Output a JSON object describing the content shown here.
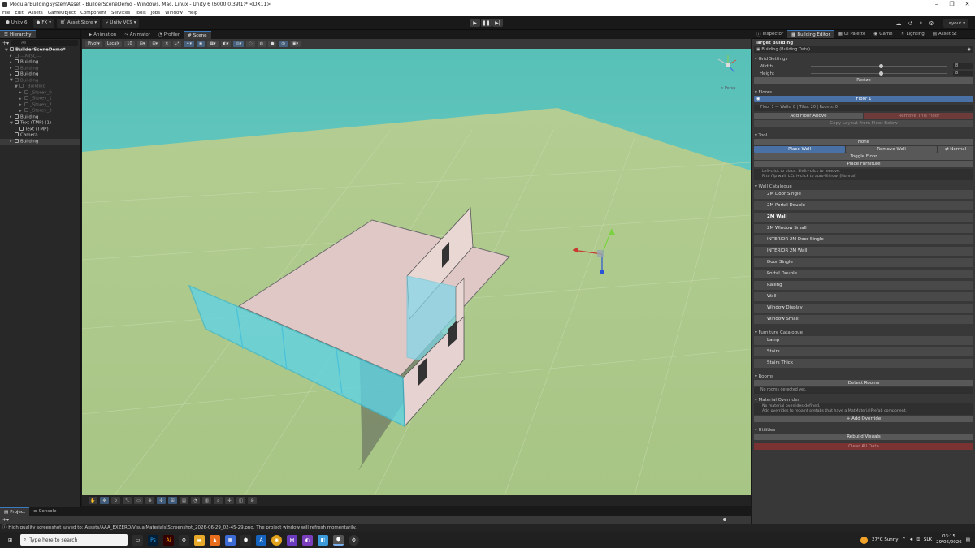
{
  "window": {
    "title": "ModularBuildingSystemAsset - BuilderSceneDemo - Windows, Mac, Linux - Unity 6 (6000.0.39f1)* <DX11>"
  },
  "menu": [
    "File",
    "Edit",
    "Assets",
    "GameObject",
    "Component",
    "Services",
    "Tools",
    "Jobs",
    "Window",
    "Help"
  ],
  "toolbar": {
    "unity": "Unity 6",
    "account": "FX",
    "asset_store": "Asset Store",
    "vcs": "Unity VCS",
    "layout": "Layout"
  },
  "hierarchy": {
    "tab": "Hierarchy",
    "search_placeholder": "All",
    "items": [
      {
        "label": "BuilderSceneDemo*",
        "indent": 0,
        "dim": false,
        "sel": false,
        "arrow": "▼",
        "root": true
      },
      {
        "label": "---MISC---",
        "indent": 1,
        "dim": true,
        "sel": false,
        "arrow": "▸"
      },
      {
        "label": "Building",
        "indent": 1,
        "dim": false,
        "sel": false,
        "arrow": "▸"
      },
      {
        "label": "Building",
        "indent": 1,
        "dim": true,
        "sel": false,
        "arrow": "▸"
      },
      {
        "label": "Building",
        "indent": 1,
        "dim": false,
        "sel": false,
        "arrow": "▸"
      },
      {
        "label": "Building",
        "indent": 1,
        "dim": true,
        "sel": false,
        "arrow": "▼"
      },
      {
        "label": "_Building",
        "indent": 2,
        "dim": true,
        "sel": false,
        "arrow": "▼"
      },
      {
        "label": "_Storey_0",
        "indent": 3,
        "dim": true,
        "sel": false,
        "arrow": "▸"
      },
      {
        "label": "_Storey_1",
        "indent": 3,
        "dim": true,
        "sel": false,
        "arrow": "▸"
      },
      {
        "label": "_Storey_2",
        "indent": 3,
        "dim": true,
        "sel": false,
        "arrow": "▸"
      },
      {
        "label": "_Storey_3",
        "indent": 3,
        "dim": true,
        "sel": false,
        "arrow": "▸"
      },
      {
        "label": "Building",
        "indent": 1,
        "dim": false,
        "sel": false,
        "arrow": "▸"
      },
      {
        "label": "Text (TMP) (1)",
        "indent": 1,
        "dim": false,
        "sel": false,
        "arrow": "▼"
      },
      {
        "label": "Text (TMP)",
        "indent": 2,
        "dim": false,
        "sel": false,
        "arrow": ""
      },
      {
        "label": "Camera",
        "indent": 1,
        "dim": false,
        "sel": false,
        "arrow": ""
      },
      {
        "label": "Building",
        "indent": 1,
        "dim": false,
        "sel": true,
        "arrow": "▸"
      }
    ]
  },
  "scene_tabs": [
    {
      "label": "Animation",
      "active": false
    },
    {
      "label": "Animator",
      "active": false
    },
    {
      "label": "Profiler",
      "active": false
    },
    {
      "label": "Scene",
      "active": true
    }
  ],
  "scene_toolbar": {
    "pivot": "Pivot",
    "local": "Local",
    "snap": "10",
    "persp": "< Persp"
  },
  "inspector_tabs": [
    {
      "label": "Inspector",
      "active": false
    },
    {
      "label": "Building Editor",
      "active": true
    },
    {
      "label": "UI Palette",
      "active": false
    },
    {
      "label": "Game",
      "active": false
    },
    {
      "label": "Lighting",
      "active": false
    },
    {
      "label": "Asset St",
      "active": false
    }
  ],
  "inspector": {
    "target_label": "Target Building",
    "target_value": "Building (Building Data)",
    "grid": {
      "header": "Grid Settings",
      "width_label": "Width",
      "width_value": "8",
      "width_fraction": 0.5,
      "height_label": "Height",
      "height_value": "8",
      "height_fraction": 0.5,
      "resize": "Resize"
    },
    "floors": {
      "header": "Floors",
      "floor_name": "Floor 1",
      "floor_info": "Floor 1 — Walls: 8 | Tiles: 20 | Rooms: 0",
      "add_above": "Add Floor Above",
      "remove": "Remove This Floor",
      "copy": "Copy Layout From Floor Below"
    },
    "tool": {
      "header": "Tool",
      "none": "None",
      "place_wall": "Place Wall",
      "remove_wall": "Remove Wall",
      "normal": "⇄ Normal",
      "toggle_floor": "Toggle Floor",
      "place_furniture": "Place Furniture",
      "hint1": "Left-click to place. Shift+click to remove.",
      "hint2": "R to flip wall. LCtrl+click to auto-fill row. [Normal]"
    },
    "wall_catalogue": {
      "header": "Wall Catalogue",
      "items": [
        "2M Door Single",
        "2M Portal Double",
        "2M Wall",
        "2M Window Small",
        "INTERIOR 2M Door Single",
        "INTERIOR 2M Wall",
        "Door Single",
        "Portal Double",
        "Railing",
        "Wall",
        "Window Display",
        "Window Small"
      ],
      "selected": "2M Wall"
    },
    "furniture_catalogue": {
      "header": "Furniture Catalogue",
      "items": [
        "Lamp",
        "Stairs",
        "Stairs Thick"
      ]
    },
    "rooms": {
      "header": "Rooms",
      "detect": "Detect Rooms",
      "none": "No rooms detected yet."
    },
    "material": {
      "header": "Material Overrides",
      "line1": "No material overrides defined.",
      "line2": "Add overrides to repaint prefabs that have a MatMaterialPrefab component.",
      "add": "+ Add Override"
    },
    "utilities": {
      "header": "Utilities",
      "rebuild": "Rebuild Visuals",
      "clear": "Clear All Data"
    }
  },
  "bottom_tabs": [
    {
      "label": "Project",
      "active": true
    },
    {
      "label": "Console",
      "active": false
    }
  ],
  "status": "High quality screenshot saved to: Assets/AAA_EXZERO/VisualMaterials\\Screenshot_2026-06-29_02-45-29.png. The project window will refresh momentarily.",
  "taskbar": {
    "search_placeholder": "Type here to search",
    "weather": "27°C  Sunny",
    "lang": "SLK",
    "time": "03:15",
    "date": "29/06/2026"
  },
  "colors": {
    "sky": "#5fc3bb",
    "ground": "#a9c78a",
    "accent": "#3a79bb",
    "wall_glass": "#5fd3e6"
  }
}
